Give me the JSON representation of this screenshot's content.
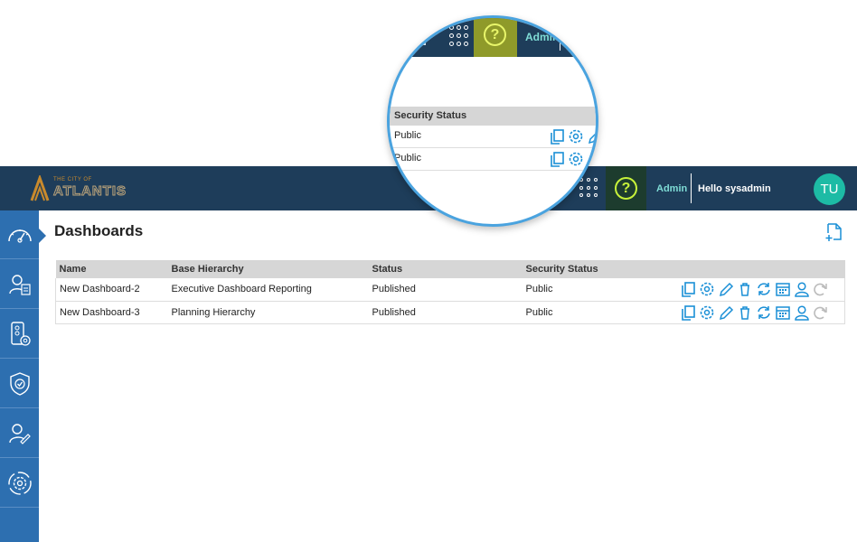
{
  "header": {
    "logo_small": "THE CITY OF",
    "logo_text": "ATLANTIS",
    "help_symbol": "?",
    "admin_label": "Admin",
    "greeting": "Hello sysadmin",
    "avatar_initials": "TU"
  },
  "sidebar": {
    "items": [
      {
        "icon": "speedometer-icon"
      },
      {
        "icon": "user-list-icon"
      },
      {
        "icon": "device-settings-icon"
      },
      {
        "icon": "shield-check-icon"
      },
      {
        "icon": "user-edit-icon"
      },
      {
        "icon": "settings-gear-icon"
      }
    ]
  },
  "main": {
    "title": "Dashboards",
    "table": {
      "columns": [
        "Name",
        "Base Hierarchy",
        "Status",
        "Security Status"
      ],
      "rows": [
        {
          "name": "New Dashboard-2",
          "hierarchy": "Executive Dashboard Reporting",
          "status": "Published",
          "security": "Public"
        },
        {
          "name": "New Dashboard-3",
          "hierarchy": "Planning Hierarchy",
          "status": "Published",
          "security": "Public"
        }
      ]
    },
    "row_actions": [
      "copy-icon",
      "settings-icon",
      "edit-icon",
      "delete-icon",
      "refresh-icon",
      "calendar-icon",
      "user-icon",
      "redo-icon"
    ]
  },
  "magnifier": {
    "admin_label": "Admin",
    "help_symbol": "?",
    "header": "Security Status",
    "rows": [
      "Public",
      "Public"
    ]
  },
  "colors": {
    "topbar": "#1e3d5a",
    "sidebar": "#2d6fb0",
    "accent": "#1a8fd6",
    "help_accent": "#c7f23a",
    "avatar": "#1dbba5"
  }
}
